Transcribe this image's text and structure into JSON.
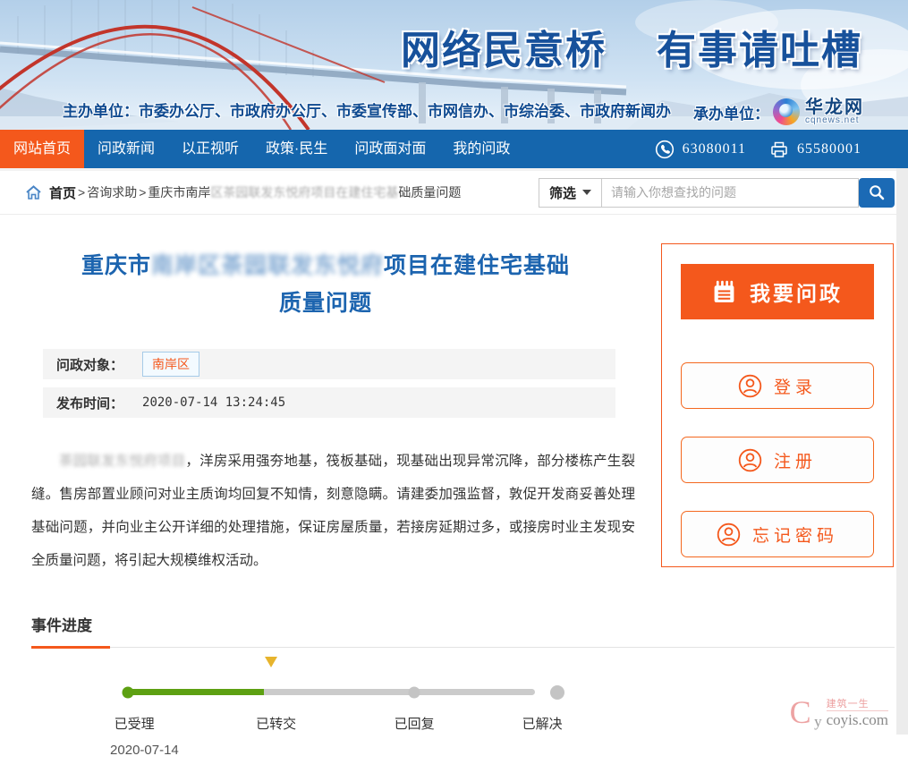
{
  "banner": {
    "title_part1": "网络民意桥",
    "title_part2": "有事请吐槽",
    "organizer_label": "主办单位：",
    "organizers": "市委办公厅、市政府办公厅、市委宣传部、市网信办、市综治委、市政府新闻办",
    "undertaker_label": "承办单位：",
    "undertaker_name": "华龙网",
    "undertaker_domain": "cqnews.net"
  },
  "navbar": {
    "items": [
      {
        "label": "网站首页",
        "active": true
      },
      {
        "label": "问政新闻",
        "active": false
      },
      {
        "label": "以正视听",
        "active": false
      },
      {
        "label": "政策·民生",
        "active": false
      },
      {
        "label": "问政面对面",
        "active": false
      },
      {
        "label": "我的问政",
        "active": false
      }
    ],
    "phone": "63080011",
    "fax": "65580001"
  },
  "breadcrumb": {
    "home": "首页",
    "separator": ">",
    "section": "咨询求助",
    "page_prefix": "重庆市南岸",
    "page_redacted": "区茶园联发东悦府项目在建住宅基",
    "page_suffix": "础质量问题"
  },
  "search": {
    "filter_label": "筛选",
    "placeholder": "请输入你想查找的问题"
  },
  "article": {
    "title_prefix": "重庆市",
    "title_redacted": "南岸区茶园联发东悦府",
    "title_suffix": "项目在建住宅基础",
    "title_line2": "质量问题",
    "target_label": "问政对象：",
    "target_value": "南岸区",
    "time_label": "发布时间：",
    "time_value": "2020-07-14 13:24:45",
    "body_redacted": "茶园联发东悦府项目",
    "body_text": "，洋房采用强夯地基，筏板基础，现基础出现异常沉降，部分楼栋产生裂缝。售房部置业顾问对业主质询均回复不知情，刻意隐瞒。请建委加强监督，敦促开发商妥善处理基础问题，并向业主公开详细的处理措施，保证房屋质量，若接房延期过多，或接房时业主发现安全质量问题，将引起大规模维权活动。"
  },
  "sidebar": {
    "ask_label": "我要问政",
    "login_label": "登录",
    "register_label": "注册",
    "forgot_label": "忘记密码"
  },
  "progress": {
    "heading": "事件进度",
    "steps": [
      {
        "label": "已受理",
        "state": "done",
        "date": "2020-07-14"
      },
      {
        "label": "已转交",
        "state": "current",
        "date": ""
      },
      {
        "label": "已回复",
        "state": "pending",
        "date": ""
      },
      {
        "label": "已解决",
        "state": "pending",
        "date": ""
      }
    ]
  },
  "watermark": {
    "logo_c": "C",
    "logo_y": "y",
    "name": "建筑一生",
    "domain": "coyis.com"
  },
  "icons": {
    "phone": "phone-icon",
    "fax": "fax-icon",
    "home": "home-icon",
    "caret": "caret-down-icon",
    "search": "search-icon",
    "notepad": "notepad-icon",
    "user": "user-circle-icon"
  },
  "colors": {
    "nav_blue": "#1566ad",
    "accent_orange": "#f4581c",
    "title_blue": "#1c64af",
    "progress_green": "#5da012",
    "progress_gold": "#e7b42d",
    "progress_gray": "#c4c4c4"
  }
}
